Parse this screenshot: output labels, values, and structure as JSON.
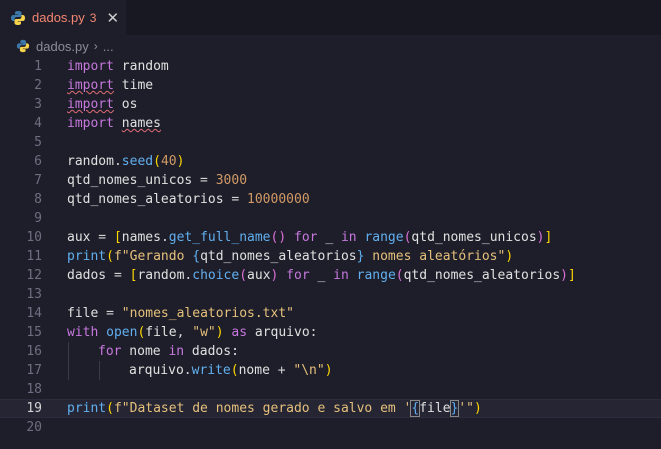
{
  "tab": {
    "filename": "dados.py",
    "problem_count": "3",
    "close": "✕"
  },
  "breadcrumb": {
    "file": "dados.py",
    "separator": "›",
    "more": "..."
  },
  "editor": {
    "active_line": 19,
    "lines": [
      {
        "n": "1"
      },
      {
        "n": "2"
      },
      {
        "n": "3"
      },
      {
        "n": "4"
      },
      {
        "n": "5"
      },
      {
        "n": "6"
      },
      {
        "n": "7"
      },
      {
        "n": "8"
      },
      {
        "n": "9"
      },
      {
        "n": "10"
      },
      {
        "n": "11"
      },
      {
        "n": "12"
      },
      {
        "n": "13"
      },
      {
        "n": "14"
      },
      {
        "n": "15"
      },
      {
        "n": "16"
      },
      {
        "n": "17"
      },
      {
        "n": "18"
      },
      {
        "n": "19"
      },
      {
        "n": "20"
      }
    ],
    "code": {
      "l1": [
        "import",
        " random"
      ],
      "l2": [
        "import",
        " time"
      ],
      "l3": [
        "import",
        " os"
      ],
      "l4": [
        "import",
        " ",
        "names"
      ],
      "l6": [
        "random",
        ".",
        "seed",
        "(",
        "40",
        ")"
      ],
      "l7": [
        "qtd_nomes_unicos",
        " = ",
        "3000"
      ],
      "l8": [
        "qtd_nomes_aleatorios",
        " = ",
        "10000000"
      ],
      "l10": [
        "aux",
        " = ",
        "[",
        "names",
        ".",
        "get_full_name",
        "()",
        " for ",
        "_",
        " in ",
        "range",
        "(",
        "qtd_nomes_unicos",
        ")",
        "]"
      ],
      "l11": [
        "print",
        "(",
        "f\"Gerando ",
        "{",
        "qtd_nomes_aleatorios",
        "}",
        " nomes aleatórios\"",
        ")"
      ],
      "l12": [
        "dados",
        " = ",
        "[",
        "random",
        ".",
        "choice",
        "(",
        "aux",
        ")",
        " for ",
        "_",
        " in ",
        "range",
        "(",
        "qtd_nomes_aleatorios",
        ")",
        "]"
      ],
      "l14": [
        "file",
        " = ",
        "\"nomes_aleatorios.txt\""
      ],
      "l15": [
        "with",
        " ",
        "open",
        "(",
        "file",
        ", ",
        "\"w\"",
        ")",
        " as ",
        "arquivo",
        ":"
      ],
      "l16": [
        "for",
        " nome ",
        "in",
        " dados:"
      ],
      "l17": [
        "arquivo",
        ".",
        "write",
        "(",
        "nome",
        " + ",
        "\"\\n\"",
        ")"
      ],
      "l19": [
        "print",
        "(",
        "f\"Dataset de nomes gerado e salvo em '",
        "{",
        "file",
        "}",
        "'\"",
        ")"
      ]
    }
  },
  "colors": {
    "keyword": "#c678dd",
    "function": "#61afef",
    "string": "#e5c07b",
    "number": "#d19a66",
    "background": "#1e1e2a"
  }
}
